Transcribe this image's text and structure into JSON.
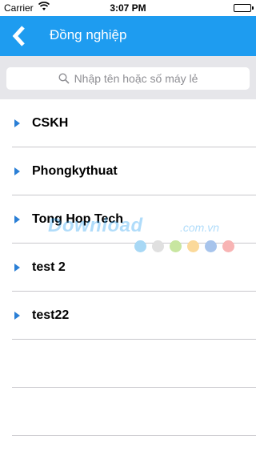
{
  "status": {
    "carrier": "Carrier",
    "time": "3:07 PM"
  },
  "nav": {
    "title": "Đồng nghiệp"
  },
  "search": {
    "placeholder": "Nhập tên hoặc số máy lẻ"
  },
  "groups": [
    {
      "label": "CSKH"
    },
    {
      "label": "Phongkythuat"
    },
    {
      "label": "Tong Hop Tech"
    },
    {
      "label": "test 2"
    },
    {
      "label": "test22"
    }
  ],
  "watermark": {
    "text": "Download",
    "suffix": ".com.vn"
  },
  "colors": {
    "nav_blue": "#1e9cf0",
    "arrow_blue": "#2a7fd6",
    "dots": [
      "#a8d8f5",
      "#e0e0e0",
      "#c8e6a0",
      "#fbd99a",
      "#a7c4ec",
      "#f8b4b4"
    ]
  }
}
